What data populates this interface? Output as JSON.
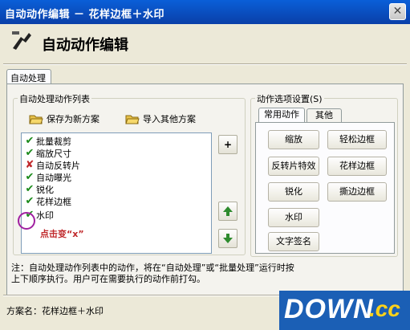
{
  "window": {
    "title": "自动动作编辑 － 花样边框＋水印",
    "close_label": "✕"
  },
  "header": {
    "title": "自动动作编辑"
  },
  "outer_tab": {
    "label": "自动处理"
  },
  "list_group": {
    "label": "自动处理动作列表",
    "save_label": "保存为新方案",
    "import_label": "导入其他方案",
    "items": [
      {
        "label": "批量裁剪",
        "state": "check"
      },
      {
        "label": "缩放尺寸",
        "state": "check"
      },
      {
        "label": "自动反转片",
        "state": "cross"
      },
      {
        "label": "自动曝光",
        "state": "check"
      },
      {
        "label": "锐化",
        "state": "check"
      },
      {
        "label": "花样边框",
        "state": "check"
      },
      {
        "label": "水印",
        "state": "check"
      }
    ],
    "add_label": "+"
  },
  "options_group": {
    "label": "动作选项设置(S)",
    "tabs": [
      "常用动作",
      "其他"
    ],
    "buttons": [
      "缩放",
      "轻松边框",
      "反转片特效",
      "花样边框",
      "锐化",
      "撕边边框",
      "水印",
      "文字签名"
    ]
  },
  "note": "注：自动处理动作列表中的动作，将在“自动处理”或“批量处理”运行时按上下顺序执行。用户可在需要执行的动作前打勾。",
  "scheme": "方案名：花样边框＋水印",
  "annotation": "点击变“x”",
  "watermark": {
    "main": "DOWN",
    "suffix": ".cc"
  },
  "colors": {
    "titlebar": "#0a4fc8",
    "check": "#1a8a1a",
    "cross": "#c0282b",
    "annotation": "#a020a0"
  }
}
